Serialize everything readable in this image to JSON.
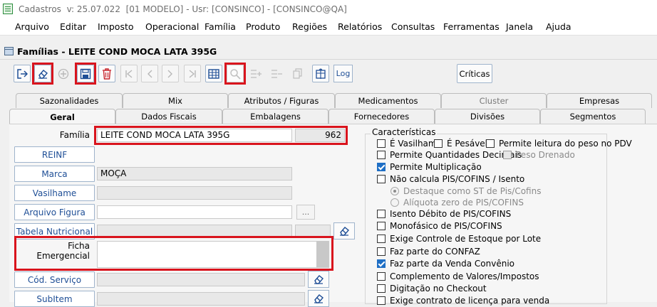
{
  "titlebar": {
    "app": "Cadastros",
    "version": "v: 25.07.022",
    "model": "[01 MODELO]",
    "user": "Usr: [CONSINCO]",
    "db": "[CONSINCO@QA]"
  },
  "menu": [
    "Arquivo",
    "Editar",
    "Imposto",
    "Operacional",
    "Família",
    "Produto",
    "Regiões",
    "Relatórios",
    "Consultas",
    "Ferramentas",
    "Janela",
    "Ajuda"
  ],
  "window": {
    "title": "Famílias - LEITE COND MOCA LATA 395G"
  },
  "toolbar": {
    "log": "Log",
    "criticas": "Críticas"
  },
  "colors": {
    "accent": "#1e4e96",
    "highlight": "#d9141d",
    "checked": "#1f6fc5"
  },
  "tabs_row1": [
    "Sazonalidades",
    "Mix",
    "Atributos / Figuras",
    "Medicamentos",
    "Cluster",
    "Empresas"
  ],
  "tabs_row2": [
    "Geral",
    "Dados Fiscais",
    "Embalagens",
    "Fornecedores",
    "Divisões",
    "Segmentos"
  ],
  "form": {
    "familia_label": "Família",
    "familia_value": "LEITE COND MOCA LATA 395G",
    "familia_code": "962",
    "reinf": "REINF",
    "marca": "Marca",
    "marca_value": "MOÇA",
    "vasilhame": "Vasilhame",
    "arquivo_figura": "Arquivo Figura",
    "dots": "...",
    "tabela_nutricional": "Tabela Nutricional",
    "ficha_emergencial": "Ficha Emergencial",
    "cod_servico": "Cód. Serviço",
    "subitem": "SubItem"
  },
  "caracteristicas": {
    "title": "Características",
    "e_vasilhame": "É Vasilhame",
    "e_pesavel": "É Pesável",
    "permite_leitura": "Permite leitura do peso no PDV",
    "permite_qtd": "Permite Quantidades Decimais",
    "peso_drenado": "Peso Drenado",
    "permite_mult": "Permite Multiplicação",
    "nao_calcula": "Não calcula PIS/COFINS / Isento",
    "destaque": "Destaque como ST de Pis/Cofins",
    "aliquota": "Alíquota zero de PIS/COFINS",
    "isento": "Isento Débito de PIS/COFINS",
    "monofasico": "Monofásico de PIS/COFINS",
    "exige_estoque": "Exige Controle de Estoque por Lote",
    "confaz": "Faz parte do CONFAZ",
    "venda_convenio": "Faz parte da Venda Convênio",
    "complemento": "Complemento de Valores/Impostos",
    "digitacao": "Digitação no Checkout",
    "exige_licenca": "Exige contrato de licença para venda"
  }
}
